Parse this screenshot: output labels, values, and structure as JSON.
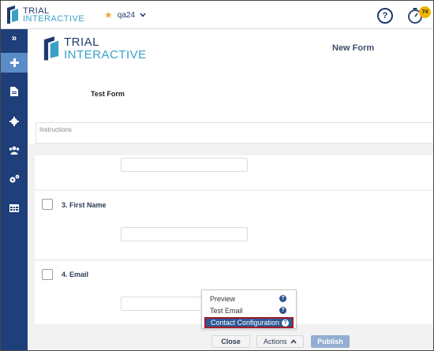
{
  "header": {
    "brand_line1": "TRIAL",
    "brand_line2": "INTERACTIVE",
    "study_name": "qa24",
    "help_icon_text": "?",
    "timer_badge": "74"
  },
  "sidebar": {
    "expand_glyph": "»",
    "items": [
      {
        "icon": "plus-icon"
      },
      {
        "icon": "document-icon"
      },
      {
        "icon": "gear-icon"
      },
      {
        "icon": "users-icon"
      },
      {
        "icon": "cogs-icon"
      },
      {
        "icon": "table-icon"
      }
    ]
  },
  "main": {
    "logo_line1": "TRIAL",
    "logo_line2": "INTERACTIVE",
    "form_title": "New Form",
    "form_name": "Test Form",
    "instructions_placeholder": "Instructions",
    "questions": [
      {
        "label": "3. First Name"
      },
      {
        "label": "4. Email"
      }
    ]
  },
  "actions_menu": {
    "items": [
      {
        "label": "Preview",
        "help": "?"
      },
      {
        "label": "Test Email",
        "help": "?"
      },
      {
        "label": "Contact Configuration",
        "help": "?"
      }
    ]
  },
  "footer": {
    "close_label": "Close",
    "actions_label": "Actions",
    "publish_label": "Publish"
  },
  "colors": {
    "navy": "#1e3a6e",
    "teal": "#3aa0c8",
    "sidebar": "#1e3f7a",
    "sidebar_active": "#5a8cc8",
    "menu_highlight": "#2d5a96",
    "highlight_border": "#a01a2a",
    "badge": "#f4b400",
    "publish": "#93aed0"
  }
}
